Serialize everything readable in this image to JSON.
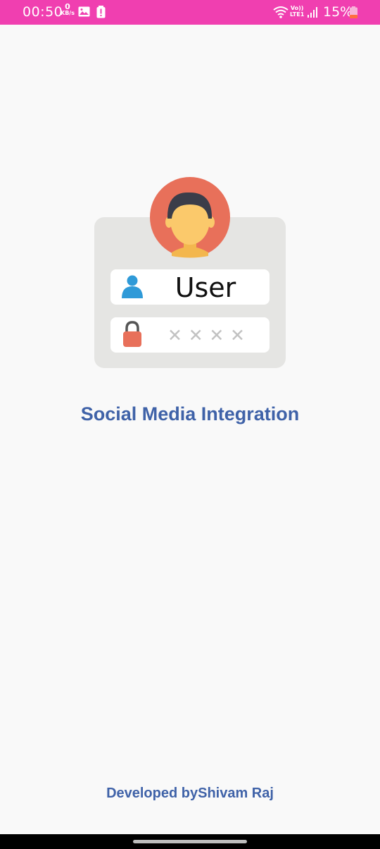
{
  "status_bar": {
    "time": "00:50",
    "net_speed_value": "0",
    "net_speed_unit": "KB/s",
    "volte_top": "Vo))",
    "volte_bottom": "LTE1",
    "battery": "15%",
    "icons": [
      "gallery-icon",
      "alert-icon",
      "wifi-icon",
      "signal-icon",
      "battery-icon"
    ],
    "background_color": "#f03fb0"
  },
  "illustration": {
    "username_text": "User",
    "password_mask": "✕ ✕ ✕ ✕",
    "icons": [
      "avatar",
      "user-icon",
      "lock-icon"
    ]
  },
  "main": {
    "title": "Social Media Integration",
    "title_color": "#3f62a8"
  },
  "footer": {
    "credit": "Developed byShivam Raj"
  }
}
